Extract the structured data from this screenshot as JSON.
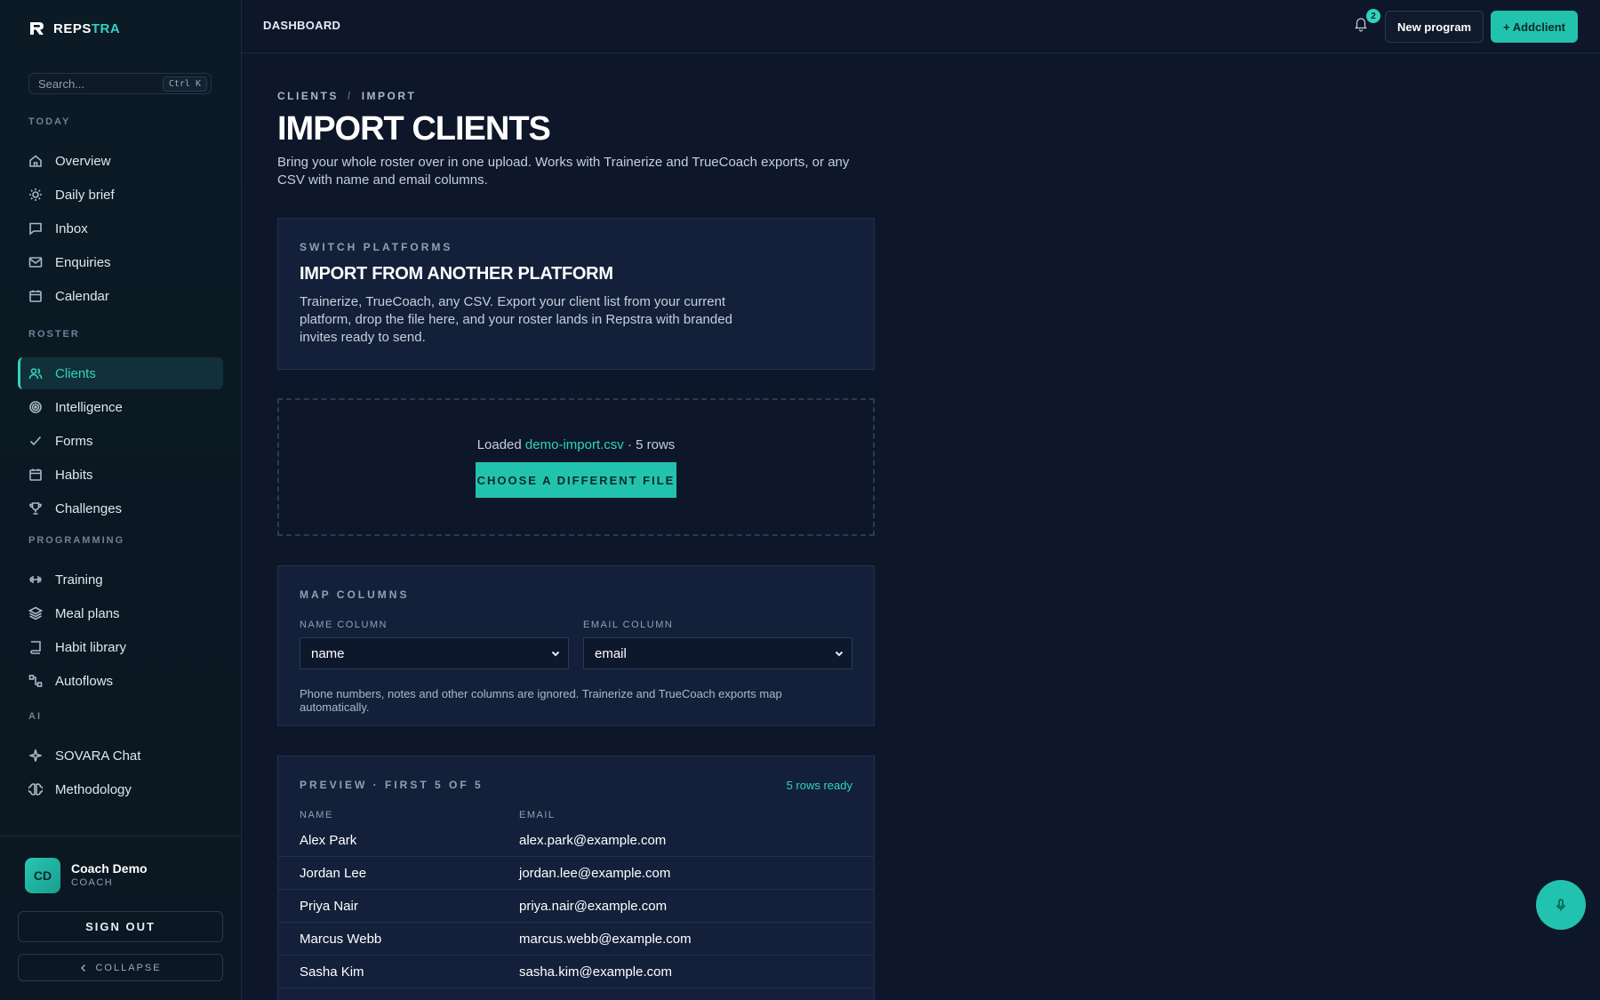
{
  "brand": {
    "name_prefix": "REPS",
    "name_accent": "TRA"
  },
  "search": {
    "placeholder": "Search...",
    "shortcut": "Ctrl K"
  },
  "sidebar": {
    "sections": [
      {
        "label": "TODAY",
        "items": [
          {
            "label": "Overview",
            "icon": "home-icon"
          },
          {
            "label": "Daily brief",
            "icon": "sun-icon"
          },
          {
            "label": "Inbox",
            "icon": "message-icon"
          },
          {
            "label": "Enquiries",
            "icon": "mail-icon"
          },
          {
            "label": "Calendar",
            "icon": "calendar-icon"
          }
        ]
      },
      {
        "label": "ROSTER",
        "items": [
          {
            "label": "Clients",
            "icon": "users-icon",
            "active": true
          },
          {
            "label": "Intelligence",
            "icon": "target-icon"
          },
          {
            "label": "Forms",
            "icon": "check-icon"
          },
          {
            "label": "Habits",
            "icon": "calendar-icon"
          },
          {
            "label": "Challenges",
            "icon": "trophy-icon"
          }
        ]
      },
      {
        "label": "PROGRAMMING",
        "items": [
          {
            "label": "Training",
            "icon": "dumbbell-icon"
          },
          {
            "label": "Meal plans",
            "icon": "layers-icon"
          },
          {
            "label": "Habit library",
            "icon": "book-icon"
          },
          {
            "label": "Autoflows",
            "icon": "flow-icon"
          }
        ]
      },
      {
        "label": "AI",
        "items": [
          {
            "label": "SOVARA Chat",
            "icon": "sparkle-icon"
          },
          {
            "label": "Methodology",
            "icon": "brain-icon"
          }
        ]
      }
    ]
  },
  "user": {
    "initials": "CD",
    "name": "Coach Demo",
    "role": "COACH"
  },
  "sidebar_footer": {
    "sign_out": "SIGN OUT",
    "collapse": "COLLAPSE"
  },
  "topbar": {
    "title": "DASHBOARD",
    "notifications": "2",
    "new_program": "New program",
    "add_client": "+ Addclient"
  },
  "breadcrumb": [
    "CLIENTS",
    "IMPORT"
  ],
  "page": {
    "title": "IMPORT CLIENTS",
    "description": "Bring your whole roster over in one upload. Works with Trainerize and TrueCoach exports, or any CSV with name and email columns."
  },
  "switch_card": {
    "eyebrow": "SWITCH PLATFORMS",
    "title": "IMPORT FROM ANOTHER PLATFORM",
    "body": "Trainerize, TrueCoach, any CSV. Export your client list from your current platform, drop the file here, and your roster lands in Repstra with branded invites ready to send."
  },
  "upload": {
    "loaded_prefix": "Loaded",
    "file_name": "demo-import.csv",
    "row_info": "· 5 rows",
    "choose_button": "CHOOSE A DIFFERENT FILE"
  },
  "mapping": {
    "eyebrow": "MAP COLUMNS",
    "name_label": "NAME COLUMN",
    "name_value": "name",
    "email_label": "EMAIL COLUMN",
    "email_value": "email",
    "hint": "Phone numbers, notes and other columns are ignored. Trainerize and TrueCoach exports map automatically."
  },
  "preview": {
    "eyebrow": "PREVIEW · FIRST 5 OF 5",
    "ready": "5 rows ready",
    "columns": [
      "NAME",
      "EMAIL"
    ],
    "rows": [
      {
        "name": "Alex Park",
        "email": "alex.park@example.com"
      },
      {
        "name": "Jordan Lee",
        "email": "jordan.lee@example.com"
      },
      {
        "name": "Priya Nair",
        "email": "priya.nair@example.com"
      },
      {
        "name": "Marcus Webb",
        "email": "marcus.webb@example.com"
      },
      {
        "name": "Sasha Kim",
        "email": "sasha.kim@example.com"
      }
    ]
  },
  "colors": {
    "accent": "#2fd3bf",
    "button": "#22c3ae",
    "background": "#0d1729",
    "card": "#14203a"
  }
}
